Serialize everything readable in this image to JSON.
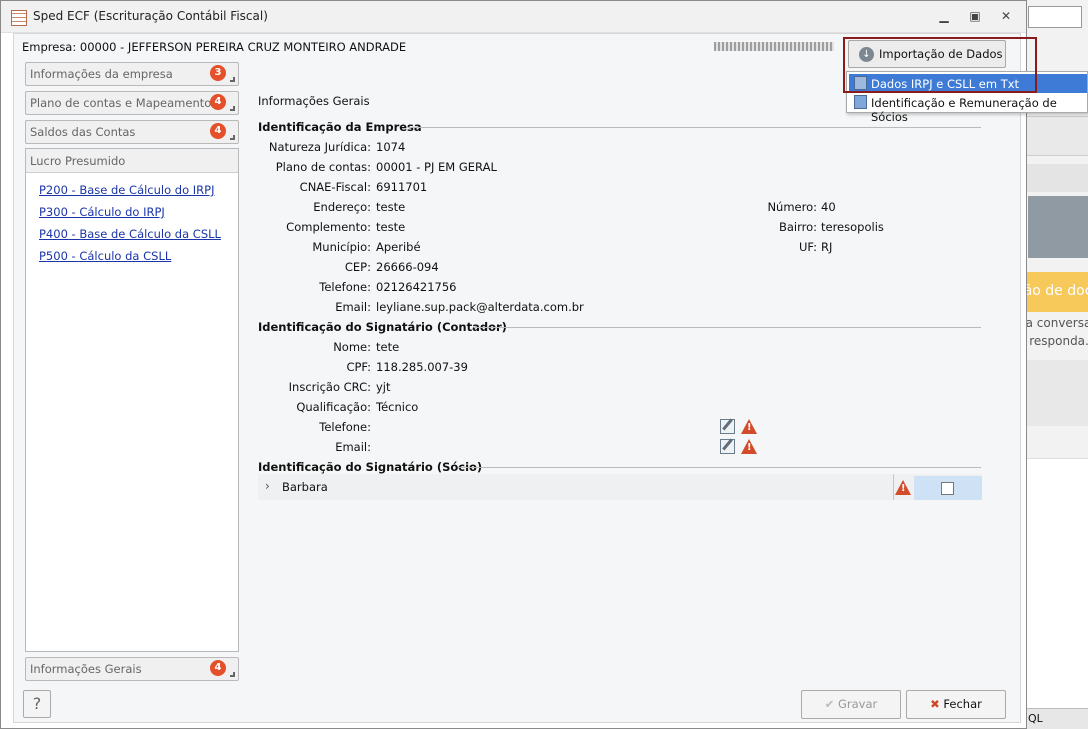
{
  "window": {
    "title": "Sped ECF (Escrituração Contábil Fiscal)"
  },
  "header": {
    "empresa": "Empresa: 00000 - JEFFERSON PEREIRA CRUZ MONTEIRO ANDRADE"
  },
  "import": {
    "button_label": "Importação de Dados",
    "menu": [
      "Dados IRPJ e CSLL em Txt",
      "Identificação e Remuneração de Sócios"
    ]
  },
  "sidebar": {
    "items": [
      {
        "label": "Informações da empresa",
        "badge": "3"
      },
      {
        "label": "Plano de contas e Mapeamento",
        "badge": "4"
      },
      {
        "label": "Saldos das Contas",
        "badge": "4"
      }
    ],
    "lucro_title": "Lucro Presumido",
    "lucro_links": [
      "P200 - Base de Cálculo do IRPJ",
      "P300 - Cálculo do IRPJ",
      "P400 - Base de Cálculo da CSLL",
      "P500 - Cálculo da CSLL"
    ],
    "bottom": {
      "label": "Informações Gerais",
      "badge": "4"
    }
  },
  "form": {
    "title": "Informações Gerais",
    "empresa_section": "Identificação da Empresa",
    "empresa_fields": [
      {
        "label": "Natureza Jurídica:",
        "value": "1074"
      },
      {
        "label": "Plano de contas:",
        "value": "00001 - PJ EM GERAL"
      },
      {
        "label": "CNAE-Fiscal:",
        "value": "6911701"
      },
      {
        "label": "Endereço:",
        "value": "teste"
      },
      {
        "label": "Complemento:",
        "value": "teste"
      },
      {
        "label": "Município:",
        "value": "Aperibé"
      },
      {
        "label": "CEP:",
        "value": "26666-094"
      },
      {
        "label": "Telefone:",
        "value": "02126421756"
      },
      {
        "label": "Email:",
        "value": "leyliane.sup.pack@alterdata.com.br"
      }
    ],
    "empresa_right": [
      {
        "label": "Número:",
        "value": "40"
      },
      {
        "label": "Bairro:",
        "value": "teresopolis"
      },
      {
        "label": "UF:",
        "value": "RJ"
      }
    ],
    "contador_section": "Identificação do Signatário (Contador)",
    "contador_fields": [
      {
        "label": "Nome:",
        "value": "tete"
      },
      {
        "label": "CPF:",
        "value": "118.285.007-39"
      },
      {
        "label": "Inscrição CRC:",
        "value": "yjt"
      },
      {
        "label": "Qualificação:",
        "value": "Técnico"
      },
      {
        "label": "Telefone:",
        "value": ""
      },
      {
        "label": "Email:",
        "value": ""
      }
    ],
    "socio_section": "Identificação do Signatário (Sócio)",
    "socio_name": "Barbara"
  },
  "footer": {
    "help": "?",
    "gravar": "Gravar",
    "fechar": "Fechar"
  },
  "background": {
    "banner_text": "ção de doc",
    "line1": "na conversa",
    "line2": "e responda.",
    "bottom_tab": "QL"
  },
  "colors": {
    "badge": "#e4502a",
    "link": "#1a35a8",
    "menu_active": "#3d7bd6",
    "highlight": "#8b1a1a"
  }
}
